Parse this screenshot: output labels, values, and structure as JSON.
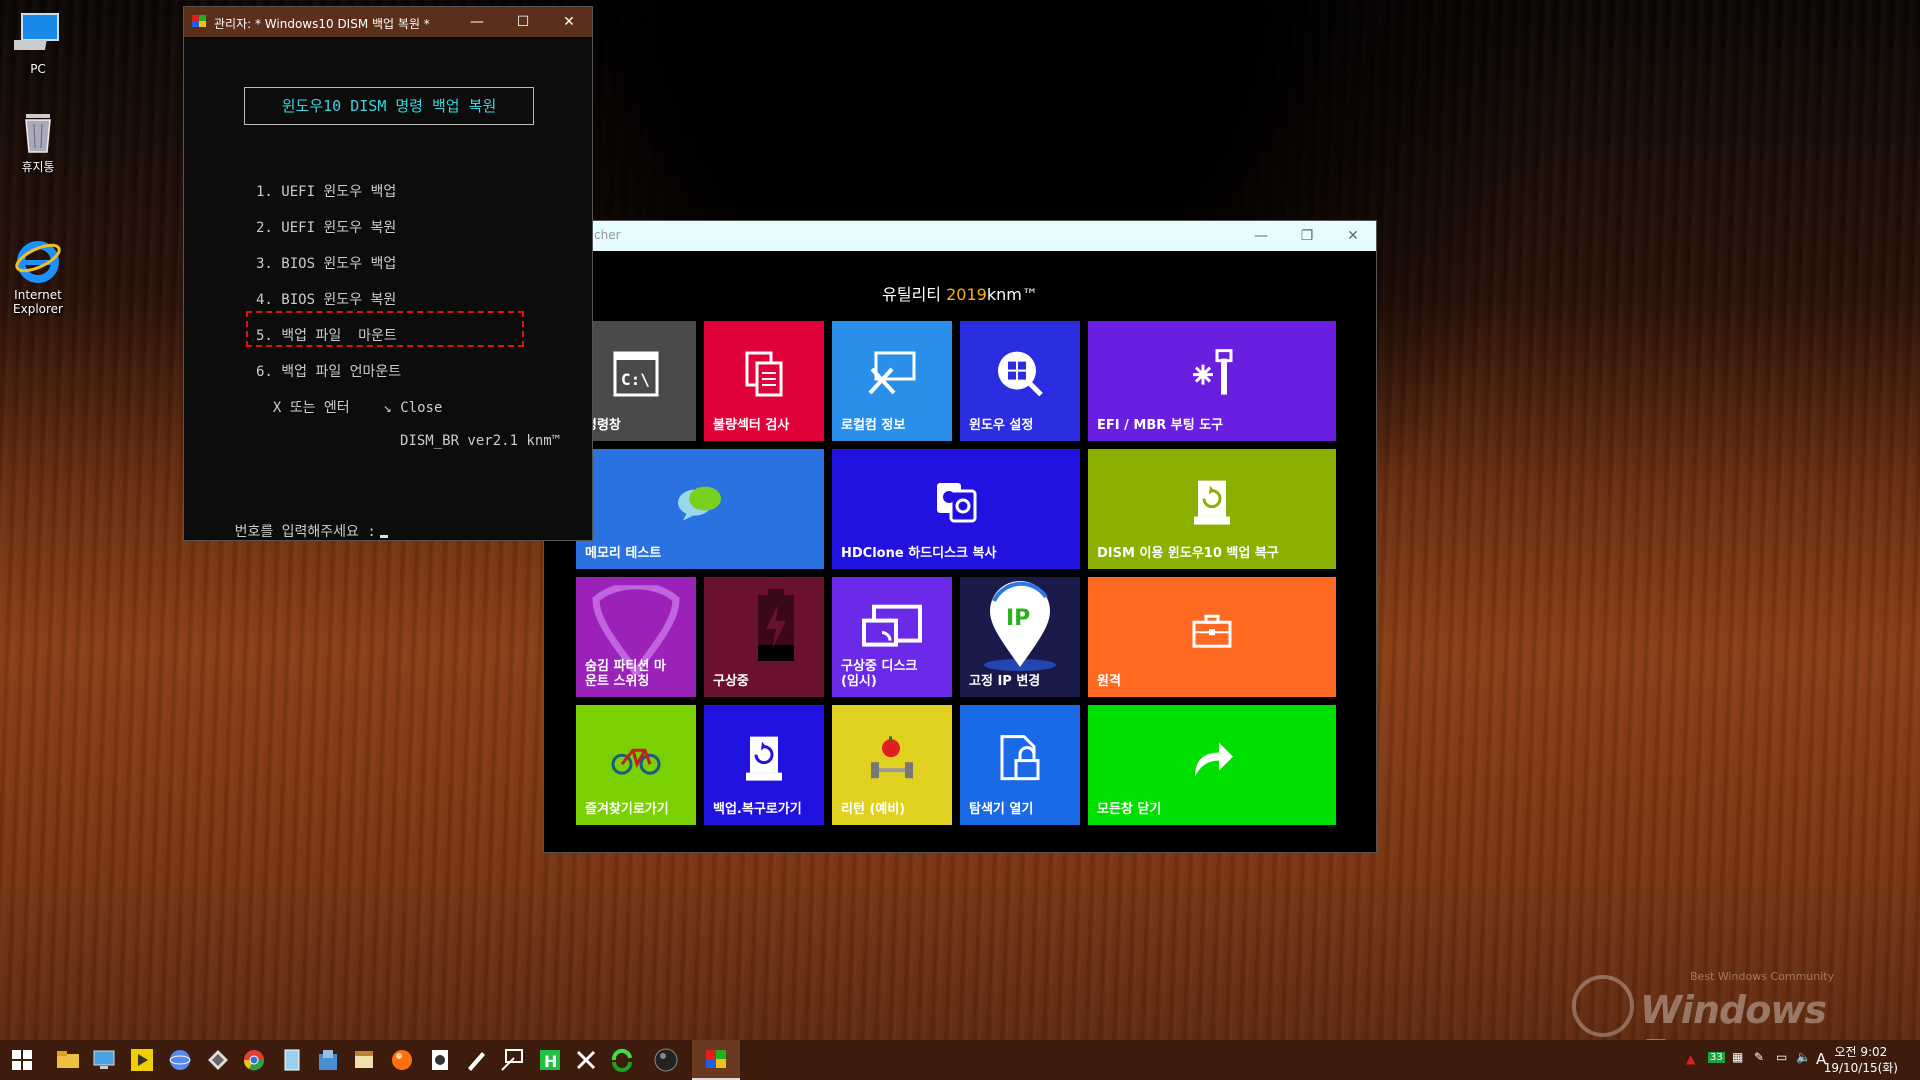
{
  "desktop": {
    "icons": [
      {
        "label": "PC"
      },
      {
        "label": "휴지통"
      },
      {
        "label": "Internet\nExplorer"
      }
    ]
  },
  "console": {
    "title": "관리자:  * Windows10 DISM 백업 복원 *",
    "box_title": "윈도우10 DISM 명령 백업 복원",
    "menu": [
      "1. UEFI 윈도우 백업",
      "2. UEFI 윈도우 복원",
      "3. BIOS 윈도우 백업",
      "4. BIOS 윈도우 복원",
      "5. 백업 파일  마운트",
      "6. 백업 파일 언마운트",
      "  X 또는 엔터    ↘ Close"
    ],
    "version": "DISM_BR ver2.1 knm™",
    "prompt": "번호를 입력해주세요 :",
    "highlighted_item": "4. BIOS 윈도우 복원"
  },
  "launcher": {
    "title": "cher",
    "heading_prefix": "유틸리티",
    "heading_year": "2019",
    "heading_suffix": "knm™",
    "tiles": [
      {
        "label": "명령창",
        "color": "#4a4a4a",
        "icon": "console-icon"
      },
      {
        "label": "불량섹터 검사",
        "color": "#e0003a",
        "icon": "document-icon"
      },
      {
        "label": "로컬컴 정보",
        "color": "#2a8fe8",
        "icon": "tools-icon"
      },
      {
        "label": "윈도우 설정",
        "color": "#2a2ee0",
        "icon": "windows-search-icon"
      },
      {
        "label": "EFI / MBR 부팅 도구",
        "color": "#6a1ee0",
        "icon": "repair-icon"
      },
      {
        "label": "메모리 테스트",
        "color": "#2a72e0",
        "icon": "chat-bubble-icon"
      },
      {
        "label": "HDClone 하드디스크 복사",
        "color": "#2212e0",
        "icon": "disk-copy-icon"
      },
      {
        "label": "DISM 이용 윈도우10 백업 복구",
        "color": "#8ab000",
        "icon": "drive-restore-icon"
      },
      {
        "label": "숨김 파티션 마\n운트 스위칭",
        "color": "#9a22b8",
        "icon": "pick-icon"
      },
      {
        "label": "구상중",
        "color": "#6a1030",
        "icon": "battery-icon"
      },
      {
        "label": "구상중 디스크\n(임시)",
        "color": "#6a2ae8",
        "icon": "cast-icon"
      },
      {
        "label": "고정 IP 변경",
        "color": "#1a1a4a",
        "icon": "ip-pin-icon"
      },
      {
        "label": "원격",
        "color": "#ff6a22",
        "icon": "briefcase-icon"
      },
      {
        "label": "즐겨찾기로가기",
        "color": "#7ad000",
        "icon": "bicycle-icon"
      },
      {
        "label": "백업.복구로가기",
        "color": "#2212e0",
        "icon": "drive-backup-icon"
      },
      {
        "label": "리턴 (예비)",
        "color": "#e0d020",
        "icon": "dumbbell-apple-icon"
      },
      {
        "label": "탐색기 열기",
        "color": "#1a6ae8",
        "icon": "lock-file-icon"
      },
      {
        "label": "모든창 닫기",
        "color": "#00e000",
        "icon": "forward-arrow-icon"
      }
    ]
  },
  "watermark": {
    "text": "Windows Forum",
    "subtext": "Best Windows Community"
  },
  "taskbar": {
    "tray_badge": "33",
    "ime": "A",
    "clock_time": "오전 9:02",
    "clock_date": "19/10/15(화)"
  }
}
